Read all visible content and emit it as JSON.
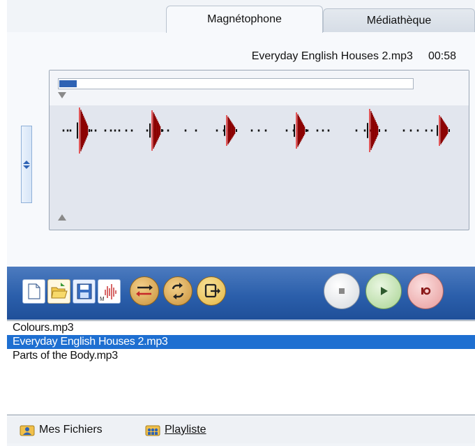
{
  "tabs": [
    {
      "label": "Magnétophone",
      "active": true
    },
    {
      "label": "Médiathèque",
      "active": false
    }
  ],
  "recorder": {
    "current_file": "Everyday English Houses 2.mp3",
    "time": "00:58",
    "progress_fraction": 0.05
  },
  "toolbar": {
    "file_icons": [
      "new-file-icon",
      "open-folder-icon",
      "save-disk-icon",
      "waveform-edit-icon"
    ],
    "action_icons": [
      "transfer-icon",
      "loop-icon",
      "export-icon"
    ],
    "transport_icons": [
      "stop-icon",
      "play-icon",
      "record-icon"
    ],
    "colors": {
      "toolbar_bg": "#2b5fab",
      "round_btn": "#e2b25a",
      "play": "#bfe0b0",
      "record": "#f0a8a8"
    }
  },
  "files": [
    {
      "name": "Colours.mp3",
      "selected": false
    },
    {
      "name": "Everyday English Houses 2.mp3",
      "selected": true
    },
    {
      "name": "Parts of the Body.mp3",
      "selected": false
    }
  ],
  "bottom_nav": {
    "my_files": "Mes Fichiers",
    "playlist": "Playliste"
  },
  "colors": {
    "selection": "#1e6fd1",
    "waveform": "#8b0000"
  }
}
